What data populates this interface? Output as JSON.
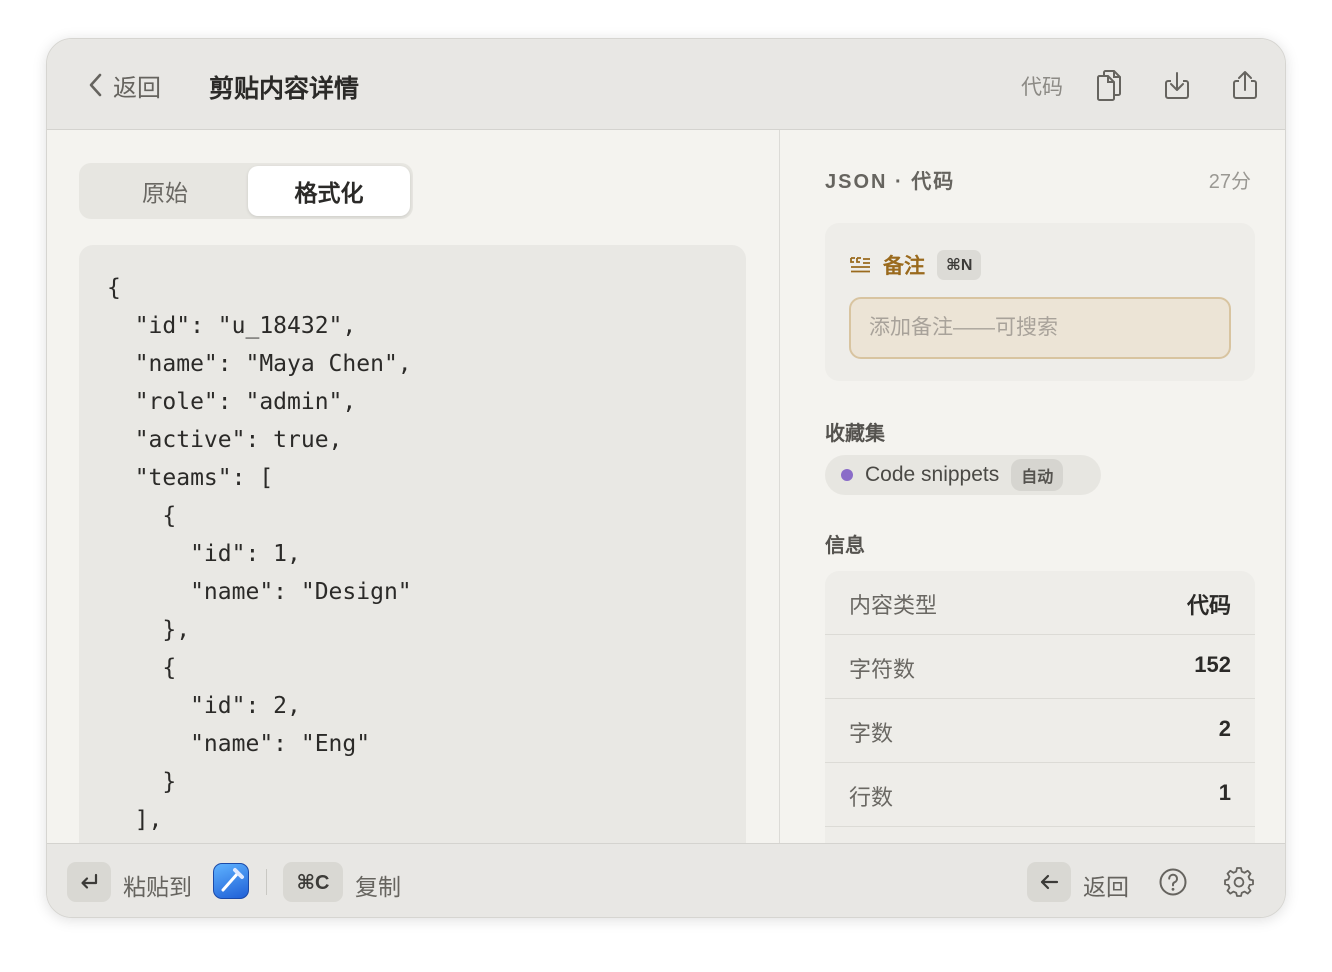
{
  "header": {
    "back_label": "返回",
    "title": "剪贴内容详情",
    "type_label": "代码",
    "actions": [
      "copy-icon",
      "download-icon",
      "share-icon"
    ]
  },
  "tabs": {
    "raw": "原始",
    "formatted": "格式化",
    "selected": "格式化"
  },
  "code": {
    "lines": [
      "{",
      "  \"id\": \"u_18432\",",
      "  \"name\": \"Maya Chen\",",
      "  \"role\": \"admin\",",
      "  \"active\": true,",
      "  \"teams\": [",
      "    {",
      "      \"id\": 1,",
      "      \"name\": \"Design\"",
      "    },",
      "    {",
      "      \"id\": 2,",
      "      \"name\": \"Eng\"",
      "    }",
      "  ],"
    ]
  },
  "meta": {
    "kind": "JSON · 代码",
    "age": "27分"
  },
  "note": {
    "title": "备注",
    "shortcut": "⌘N",
    "placeholder": "添加备注——可搜索",
    "value": ""
  },
  "collections": {
    "label": "收藏集",
    "chip": {
      "name": "Code snippets",
      "badge": "自动",
      "color": "#8a6cc8"
    }
  },
  "info": {
    "label": "信息",
    "rows": [
      {
        "key": "内容类型",
        "value": "代码"
      },
      {
        "key": "字符数",
        "value": "152"
      },
      {
        "key": "字数",
        "value": "2"
      },
      {
        "key": "行数",
        "value": "1"
      }
    ]
  },
  "footer": {
    "paste_key": "↵",
    "paste_label": "粘贴到",
    "copy_key": "⌘C",
    "copy_label": "复制",
    "back_key": "←",
    "back_label": "返回",
    "icons": [
      "help-icon",
      "gear-icon"
    ]
  },
  "colors": {
    "accent_note": "#9a6a1d",
    "window_bg": "#f4f3ef",
    "collection_dot": "#8a6cc8"
  }
}
